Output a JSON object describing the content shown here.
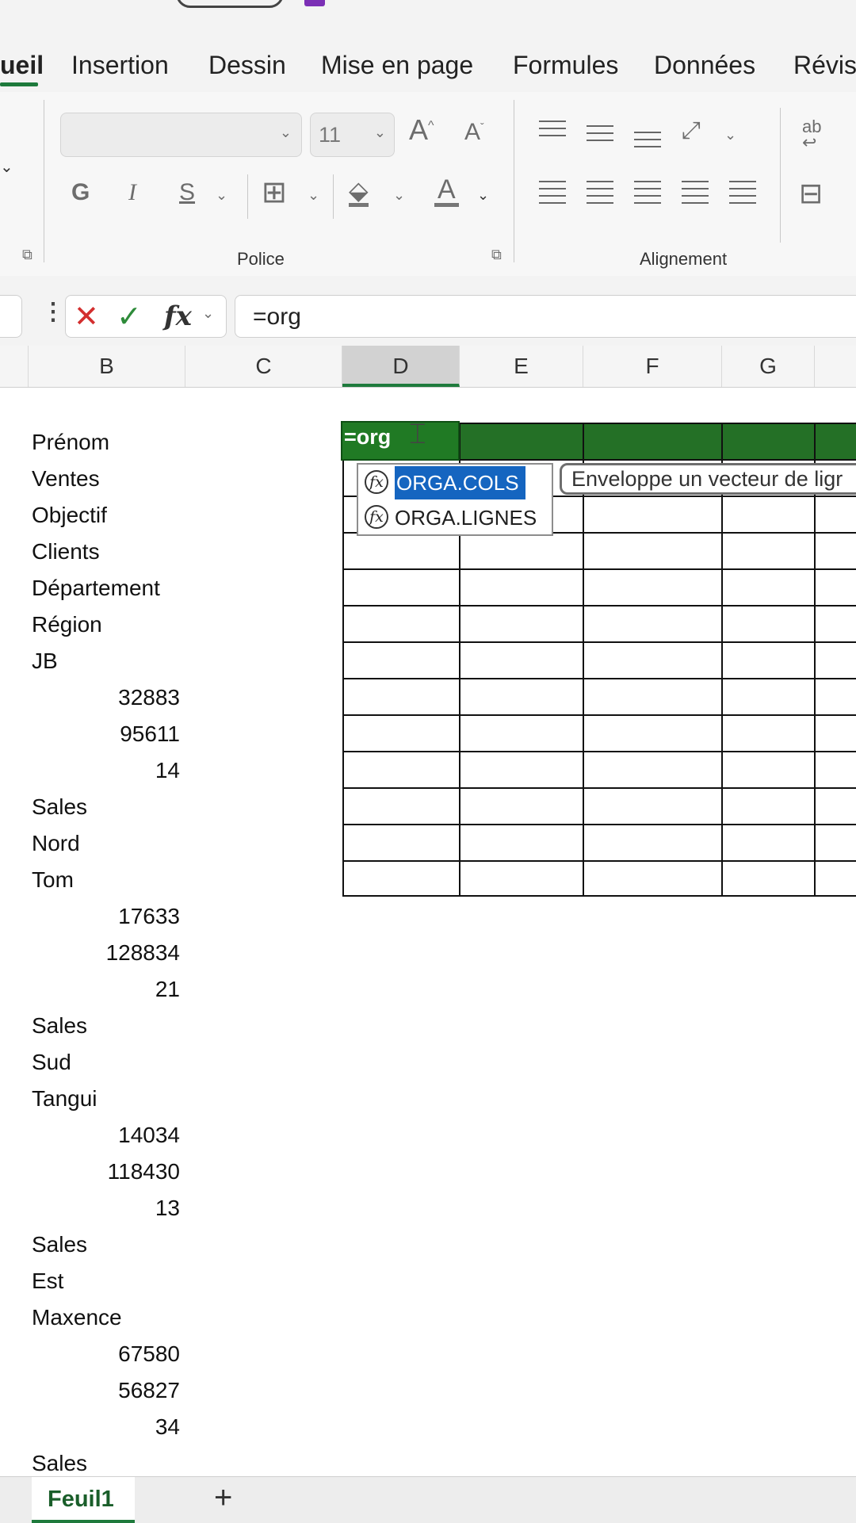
{
  "ribbon": {
    "tabs": [
      {
        "label": "ueil",
        "active": true
      },
      {
        "label": "Insertion"
      },
      {
        "label": "Dessin"
      },
      {
        "label": "Mise en page"
      },
      {
        "label": "Formules"
      },
      {
        "label": "Données"
      },
      {
        "label": "Révisi"
      }
    ],
    "font_size": "11",
    "bold_label": "G",
    "italic_label": "I",
    "strike_label": "S",
    "font_color_label": "A",
    "grow_font_label": "A",
    "shrink_font_label": "A",
    "wrap_label": "ab",
    "groups": {
      "font": "Police",
      "alignment": "Alignement"
    }
  },
  "formula_bar": {
    "cancel_glyph": "✕",
    "enter_glyph": "✓",
    "fx_glyph": "fx",
    "value": "=org"
  },
  "columns": [
    "B",
    "C",
    "D",
    "E",
    "F",
    "G"
  ],
  "selected_column": "D",
  "column_b": [
    {
      "text": "Prénom"
    },
    {
      "text": "Ventes"
    },
    {
      "text": "Objectif"
    },
    {
      "text": "Clients"
    },
    {
      "text": "Département"
    },
    {
      "text": "Région"
    },
    {
      "text": "JB"
    },
    {
      "text": "32883",
      "num": true
    },
    {
      "text": "95611",
      "num": true
    },
    {
      "text": "14",
      "num": true
    },
    {
      "text": "Sales"
    },
    {
      "text": "Nord"
    },
    {
      "text": "Tom"
    },
    {
      "text": "17633",
      "num": true
    },
    {
      "text": "128834",
      "num": true
    },
    {
      "text": "21",
      "num": true
    },
    {
      "text": "Sales"
    },
    {
      "text": "Sud"
    },
    {
      "text": "Tangui"
    },
    {
      "text": "14034",
      "num": true
    },
    {
      "text": "118430",
      "num": true
    },
    {
      "text": "13",
      "num": true
    },
    {
      "text": "Sales"
    },
    {
      "text": "Est"
    },
    {
      "text": "Maxence"
    },
    {
      "text": "67580",
      "num": true
    },
    {
      "text": "56827",
      "num": true
    },
    {
      "text": "34",
      "num": true
    },
    {
      "text": "Sales"
    }
  ],
  "active_cell": {
    "value": "=org"
  },
  "autocomplete": {
    "items": [
      {
        "label": "ORGA.COLS",
        "selected": true
      },
      {
        "label": "ORGA.LIGNES"
      }
    ],
    "tooltip": "Enveloppe un vecteur de ligr"
  },
  "sheets": {
    "tabs": [
      "Feuil1"
    ],
    "add_label": "+"
  },
  "colors": {
    "accent": "#1e7a3c",
    "header_fill": "#247026",
    "selection_blue": "#1565c0"
  }
}
